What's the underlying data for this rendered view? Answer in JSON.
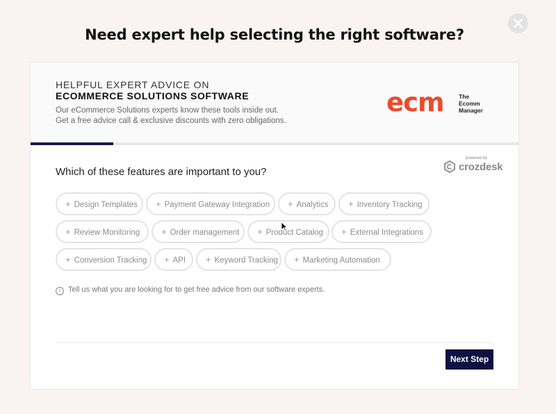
{
  "modal": {
    "title": "Need expert help selecting the right software?"
  },
  "header": {
    "line1": "HELPFUL EXPERT ADVICE ON",
    "line2": "ECOMMERCE SOLUTIONS SOFTWARE",
    "desc1": "Our eCommerce Solutions experts know these tools inside out.",
    "desc2": "Get a free advice call & exclusive discounts with zero obligations.",
    "logo": {
      "mark": "ecm",
      "tag_line1": "The",
      "tag_line2": "Ecomm",
      "tag_line3": "Manager"
    }
  },
  "progress": {
    "fraction": 0.17
  },
  "powered_by": {
    "small": "powered by",
    "brand": "crozdesk"
  },
  "question": "Which of these features are important to you?",
  "features": [
    "Design Templates",
    "Payment Gateway Integration",
    "Analytics",
    "Inventory Tracking",
    "Review Monitoring",
    "Order management",
    "Product Catalog",
    "External Integrations",
    "Conversion Tracking",
    "API",
    "Keyword Tracking",
    "Marketing Automation"
  ],
  "hint": "Tell us what you are looking for to get free advice from our software experts.",
  "next_button": "Next Step",
  "colors": {
    "accent": "#ec4a2c",
    "primary": "#0f1140",
    "progress": "#181c46"
  },
  "icons": {
    "close": "close-icon",
    "info": "info-icon",
    "plus": "plus-icon"
  }
}
